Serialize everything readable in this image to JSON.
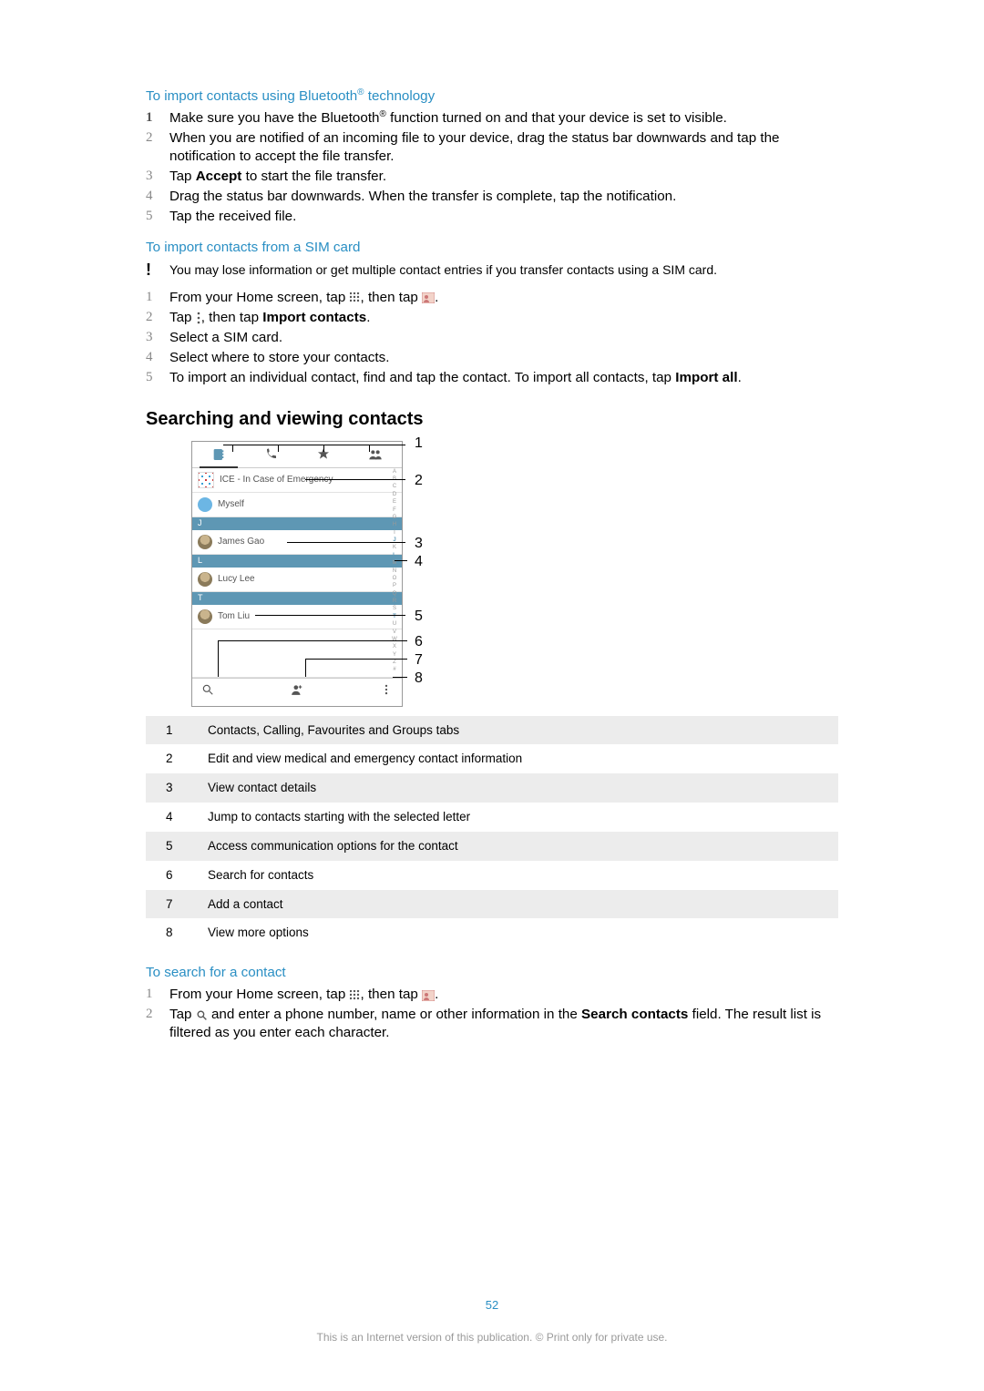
{
  "headers": {
    "bluetooth_pre": "To import contacts using Bluetooth",
    "bluetooth_post": " technology",
    "sim": "To import contacts from a SIM card",
    "search_view": "Searching and viewing contacts",
    "search_contact": "To search for a contact"
  },
  "lists": {
    "bluetooth": [
      {
        "n": "1",
        "pre": "Make sure you have the Bluetooth",
        "post": " function turned on and that your device is set to visible.",
        "sup": "®",
        "num_hl": true
      },
      {
        "n": "2",
        "pre": "When you are notified of an incoming file to your device, drag the status bar downwards and tap the notification to accept the file transfer.",
        "post": "",
        "sup": ""
      },
      {
        "n": "3",
        "pre": "Tap ",
        "bold": "Accept",
        "post": " to start the file transfer.",
        "sup": ""
      },
      {
        "n": "4",
        "pre": "Drag the status bar downwards. When the transfer is complete, tap the notification.",
        "post": "",
        "sup": ""
      },
      {
        "n": "5",
        "pre": "Tap the received file.",
        "post": "",
        "sup": ""
      }
    ],
    "sim_note": "You may lose information or get multiple contact entries if you transfer contacts using a SIM card.",
    "sim": [
      {
        "n": "1",
        "pre": "From your Home screen, tap ",
        "icon1": "apps",
        "mid": ", then tap ",
        "icon2": "contacts",
        "post": "."
      },
      {
        "n": "2",
        "pre": "Tap ",
        "icon1": "more",
        "mid": ", then tap ",
        "bold": "Import contacts",
        "post": "."
      },
      {
        "n": "3",
        "pre": "Select a SIM card."
      },
      {
        "n": "4",
        "pre": "Select where to store your contacts."
      },
      {
        "n": "5",
        "pre": "To import an individual contact, find and tap the contact. To import all contacts, tap ",
        "bold": "Import all",
        "post": "."
      }
    ],
    "search": [
      {
        "n": "1",
        "pre": "From your Home screen, tap ",
        "icon1": "apps",
        "mid": ", then tap ",
        "icon2": "contacts",
        "post": "."
      },
      {
        "n": "2",
        "pre": "Tap ",
        "icon1": "search",
        "mid": " and enter a phone number, name or other information in the ",
        "bold": "Search contacts",
        "post": " field. The result list is filtered as you enter each character."
      }
    ]
  },
  "mock": {
    "ice": "ICE - In Case of Emergency",
    "myself": "Myself",
    "sec_j": "J",
    "james": "James Gao",
    "sec_l": "L",
    "lucy": "Lucy Lee",
    "sec_t": "T",
    "tom": "Tom Liu",
    "az": [
      "A",
      "B",
      "C",
      "D",
      "E",
      "F",
      "G",
      "H",
      "I",
      "J",
      "K",
      "L",
      "M",
      "N",
      "O",
      "P",
      "Q",
      "R",
      "S",
      "T",
      "U",
      "V",
      "W",
      "X",
      "Y",
      "Z",
      "#"
    ],
    "callouts": {
      "c1": "1",
      "c2": "2",
      "c3": "3",
      "c4": "4",
      "c5": "5",
      "c6": "6",
      "c7": "7",
      "c8": "8"
    }
  },
  "legend": [
    {
      "n": "1",
      "t": "Contacts, Calling, Favourites and Groups tabs"
    },
    {
      "n": "2",
      "t": "Edit and view medical and emergency contact information"
    },
    {
      "n": "3",
      "t": "View contact details"
    },
    {
      "n": "4",
      "t": "Jump to contacts starting with the selected letter"
    },
    {
      "n": "5",
      "t": "Access communication options for the contact"
    },
    {
      "n": "6",
      "t": "Search for contacts"
    },
    {
      "n": "7",
      "t": "Add a contact"
    },
    {
      "n": "8",
      "t": "View more options"
    }
  ],
  "footer": {
    "page": "52",
    "copy": "This is an Internet version of this publication. © Print only for private use."
  }
}
